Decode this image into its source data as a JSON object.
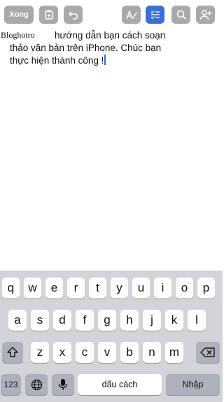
{
  "toolbar": {
    "done_label": "Xong",
    "buttons": [
      {
        "icon": "paste-icon"
      },
      {
        "icon": "undo-icon"
      },
      {
        "icon": "text-format-icon"
      },
      {
        "icon": "checklist-icon",
        "active": true
      },
      {
        "icon": "search-icon"
      },
      {
        "icon": "add-person-icon"
      }
    ],
    "active_color": "#3b6fd6"
  },
  "document": {
    "watermark": "Bloghotro",
    "line1": "hướng dẫn bạn cách soạn",
    "line2": "thảo văn bản trên iPhone. Chúc bạn",
    "line3": "thực hiện thành công !"
  },
  "keyboard": {
    "row1": [
      "q",
      "w",
      "e",
      "r",
      "t",
      "y",
      "u",
      "i",
      "o",
      "p"
    ],
    "row2": [
      "a",
      "s",
      "d",
      "f",
      "g",
      "h",
      "j",
      "k",
      "l"
    ],
    "row3": [
      "z",
      "x",
      "c",
      "v",
      "b",
      "n",
      "m"
    ],
    "numbers_label": "123",
    "space_label": "dấu cách",
    "return_label": "Nhập",
    "icons": [
      "shift-icon",
      "backspace-icon",
      "globe-icon",
      "microphone-icon"
    ]
  }
}
